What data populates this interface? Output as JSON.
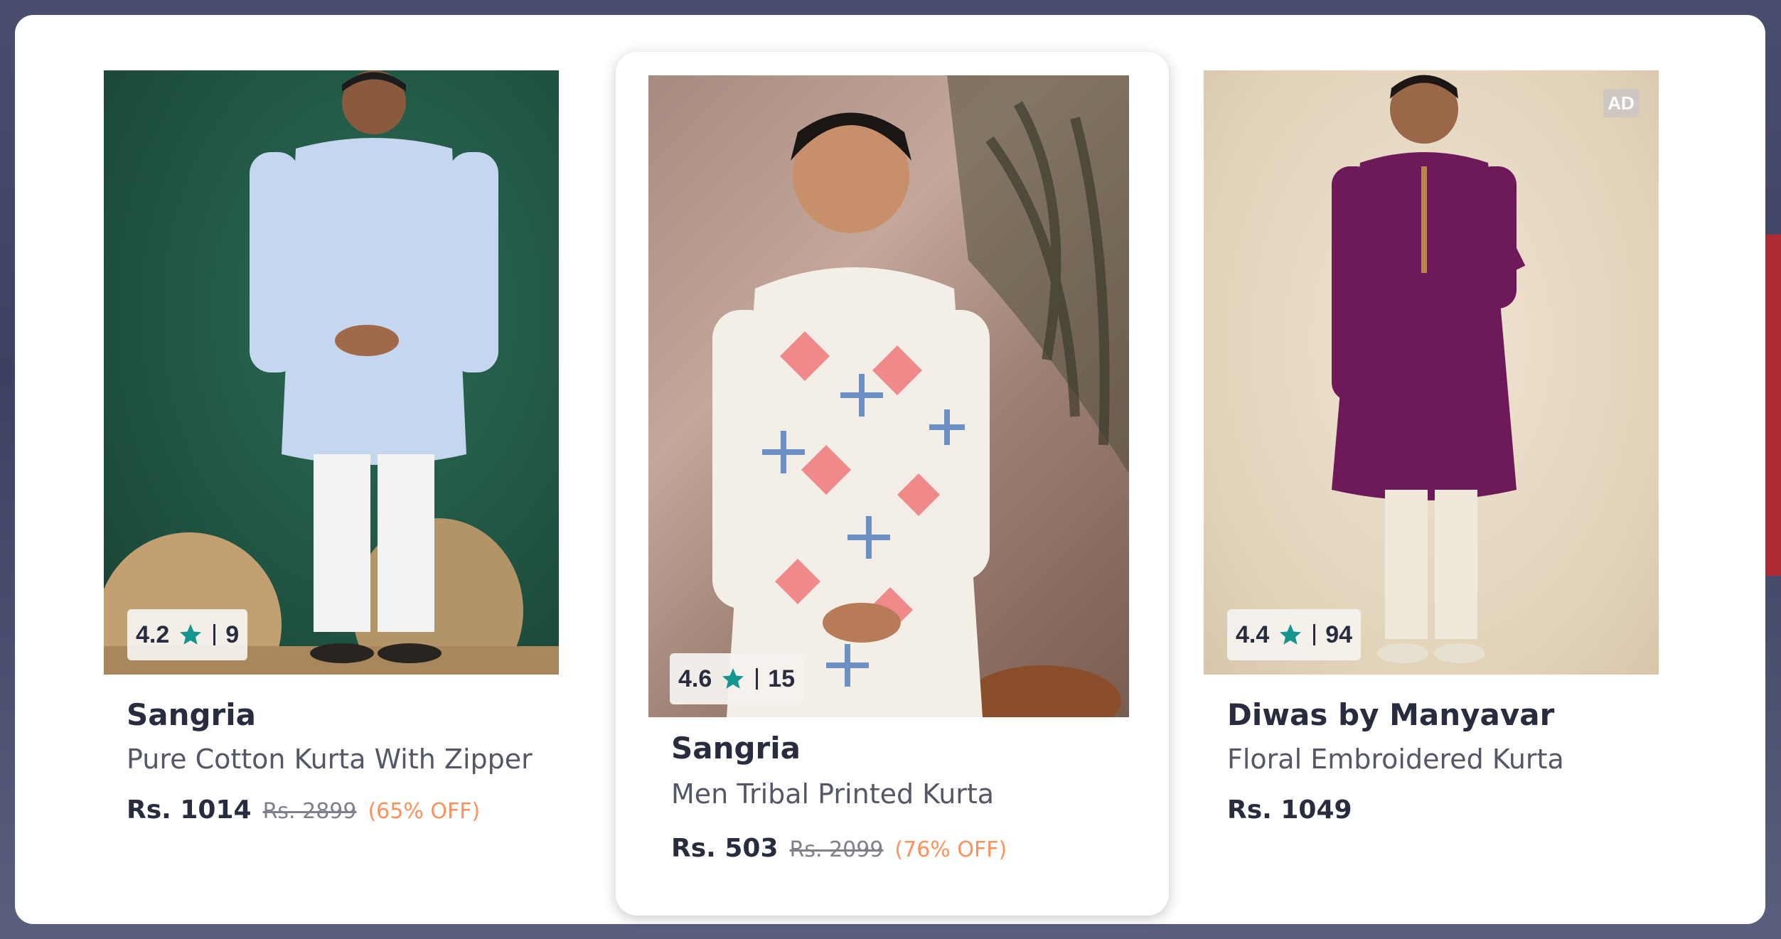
{
  "ad_label": "AD",
  "products": [
    {
      "brand": "Sangria",
      "name": "Pure Cotton Kurta With Zipper",
      "price": "Rs. 1014",
      "mrp": "Rs. 2899",
      "discount": "(65% OFF)",
      "rating": "4.2",
      "rating_count": "9"
    },
    {
      "brand": "Sangria",
      "name": "Men Tribal Printed Kurta",
      "price": "Rs. 503",
      "mrp": "Rs. 2099",
      "discount": "(76% OFF)",
      "rating": "4.6",
      "rating_count": "15"
    },
    {
      "brand": "Diwas by Manyavar",
      "name": "Floral Embroidered Kurta",
      "price": "Rs. 1049",
      "rating": "4.4",
      "rating_count": "94"
    }
  ],
  "colors": {
    "star": "#14958f",
    "discount": "#ff905a",
    "text_dark": "#282c3f"
  }
}
